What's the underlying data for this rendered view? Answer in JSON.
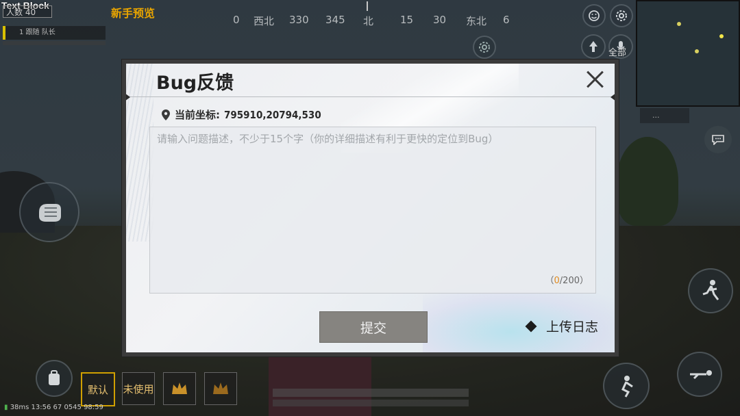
{
  "hud": {
    "text_block": "Text Block",
    "players_label": "人数 40",
    "team_bar": "1 跟随 队长",
    "top_title": "新手预览",
    "compass": [
      "0",
      "西北",
      "330",
      "345",
      "北",
      "15",
      "30",
      "东北",
      "6"
    ],
    "all_label": "全部",
    "side_tag": "...",
    "slots": [
      "默认",
      "未使用",
      "",
      ""
    ],
    "status_line": "38ms  13:56 67 0545  98:59"
  },
  "dialog": {
    "title": "Bug反馈",
    "close_icon": "close-icon",
    "coord_label": "当前坐标:",
    "coord_value": "795910,20794,530",
    "placeholder": "请输入问题描述，不少于15个字（你的详细描述有利于更快的定位到Bug）",
    "input_value": "",
    "counter_open": "（",
    "counter_current": "0",
    "counter_rest": "/200）",
    "submit_label": "提交",
    "upload_label": "上传日志",
    "colors": {
      "submit_bg": "#868480",
      "counter_accent": "#e08a1e",
      "dialog_bg": "#eceef1"
    }
  }
}
